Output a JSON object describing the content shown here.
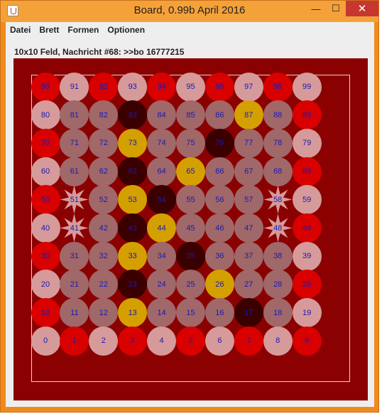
{
  "window": {
    "title": "Board, 0.99b April 2016",
    "minimize_glyph": "—",
    "maximize_glyph": "☐",
    "close_glyph": "✕"
  },
  "menu": {
    "items": [
      "Datei",
      "Brett",
      "Formen",
      "Optionen"
    ]
  },
  "status": "10x10 Feld, Nachricht #68: >>bo 16777215",
  "colors": {
    "board_bg": "#8b0000",
    "red": "#d90000",
    "pink": "#d69a9a",
    "mauve": "#a06868",
    "dark": "#3a0000",
    "gold": "#d4a000",
    "number": "#1a1ab0"
  },
  "board": {
    "columns": 10,
    "rows": 10,
    "rows_top_to_bottom": [
      [
        {
          "n": "90",
          "c": "red"
        },
        {
          "n": "91",
          "c": "pink"
        },
        {
          "n": "92",
          "c": "red"
        },
        {
          "n": "93",
          "c": "pink"
        },
        {
          "n": "94",
          "c": "red"
        },
        {
          "n": "95",
          "c": "pink"
        },
        {
          "n": "96",
          "c": "red"
        },
        {
          "n": "97",
          "c": "pink"
        },
        {
          "n": "98",
          "c": "red"
        },
        {
          "n": "99",
          "c": "pink"
        }
      ],
      [
        {
          "n": "80",
          "c": "pink"
        },
        {
          "n": "81",
          "c": "mauve"
        },
        {
          "n": "82",
          "c": "mauve"
        },
        {
          "n": "83",
          "c": "dark"
        },
        {
          "n": "84",
          "c": "mauve"
        },
        {
          "n": "85",
          "c": "mauve"
        },
        {
          "n": "86",
          "c": "mauve"
        },
        {
          "n": "87",
          "c": "gold"
        },
        {
          "n": "88",
          "c": "mauve"
        },
        {
          "n": "89",
          "c": "red"
        }
      ],
      [
        {
          "n": "70",
          "c": "red"
        },
        {
          "n": "71",
          "c": "mauve"
        },
        {
          "n": "72",
          "c": "mauve"
        },
        {
          "n": "73",
          "c": "gold"
        },
        {
          "n": "74",
          "c": "mauve"
        },
        {
          "n": "75",
          "c": "mauve"
        },
        {
          "n": "76",
          "c": "dark"
        },
        {
          "n": "77",
          "c": "mauve"
        },
        {
          "n": "78",
          "c": "mauve"
        },
        {
          "n": "79",
          "c": "pink"
        }
      ],
      [
        {
          "n": "60",
          "c": "pink"
        },
        {
          "n": "61",
          "c": "mauve"
        },
        {
          "n": "62",
          "c": "mauve"
        },
        {
          "n": "63",
          "c": "dark"
        },
        {
          "n": "64",
          "c": "mauve"
        },
        {
          "n": "65",
          "c": "gold"
        },
        {
          "n": "66",
          "c": "mauve"
        },
        {
          "n": "67",
          "c": "mauve"
        },
        {
          "n": "68",
          "c": "mauve"
        },
        {
          "n": "69",
          "c": "red"
        }
      ],
      [
        {
          "n": "50",
          "c": "red"
        },
        {
          "n": "51",
          "c": "pink",
          "s": "star"
        },
        {
          "n": "52",
          "c": "mauve"
        },
        {
          "n": "53",
          "c": "gold"
        },
        {
          "n": "54",
          "c": "dark"
        },
        {
          "n": "55",
          "c": "mauve"
        },
        {
          "n": "56",
          "c": "mauve"
        },
        {
          "n": "57",
          "c": "mauve"
        },
        {
          "n": "58",
          "c": "pink",
          "s": "star"
        },
        {
          "n": "59",
          "c": "pink"
        }
      ],
      [
        {
          "n": "40",
          "c": "pink"
        },
        {
          "n": "41",
          "c": "pink",
          "s": "star"
        },
        {
          "n": "42",
          "c": "mauve"
        },
        {
          "n": "43",
          "c": "dark"
        },
        {
          "n": "44",
          "c": "gold"
        },
        {
          "n": "45",
          "c": "mauve"
        },
        {
          "n": "46",
          "c": "mauve"
        },
        {
          "n": "47",
          "c": "mauve"
        },
        {
          "n": "48",
          "c": "pink",
          "s": "star"
        },
        {
          "n": "49",
          "c": "red"
        }
      ],
      [
        {
          "n": "30",
          "c": "red"
        },
        {
          "n": "31",
          "c": "mauve"
        },
        {
          "n": "32",
          "c": "mauve"
        },
        {
          "n": "33",
          "c": "gold"
        },
        {
          "n": "34",
          "c": "mauve"
        },
        {
          "n": "35",
          "c": "dark"
        },
        {
          "n": "36",
          "c": "mauve"
        },
        {
          "n": "37",
          "c": "mauve"
        },
        {
          "n": "38",
          "c": "mauve"
        },
        {
          "n": "39",
          "c": "pink"
        }
      ],
      [
        {
          "n": "20",
          "c": "pink"
        },
        {
          "n": "21",
          "c": "mauve"
        },
        {
          "n": "22",
          "c": "mauve"
        },
        {
          "n": "23",
          "c": "dark"
        },
        {
          "n": "24",
          "c": "mauve"
        },
        {
          "n": "25",
          "c": "mauve"
        },
        {
          "n": "26",
          "c": "gold"
        },
        {
          "n": "27",
          "c": "mauve"
        },
        {
          "n": "28",
          "c": "mauve"
        },
        {
          "n": "29",
          "c": "red"
        }
      ],
      [
        {
          "n": "10",
          "c": "red"
        },
        {
          "n": "11",
          "c": "mauve"
        },
        {
          "n": "12",
          "c": "mauve"
        },
        {
          "n": "13",
          "c": "gold"
        },
        {
          "n": "14",
          "c": "mauve"
        },
        {
          "n": "15",
          "c": "mauve"
        },
        {
          "n": "16",
          "c": "mauve"
        },
        {
          "n": "17",
          "c": "dark"
        },
        {
          "n": "18",
          "c": "mauve"
        },
        {
          "n": "19",
          "c": "pink"
        }
      ],
      [
        {
          "n": "0",
          "c": "pink"
        },
        {
          "n": "1",
          "c": "red"
        },
        {
          "n": "2",
          "c": "pink"
        },
        {
          "n": "3",
          "c": "red"
        },
        {
          "n": "4",
          "c": "pink"
        },
        {
          "n": "5",
          "c": "red"
        },
        {
          "n": "6",
          "c": "pink"
        },
        {
          "n": "7",
          "c": "red"
        },
        {
          "n": "8",
          "c": "pink"
        },
        {
          "n": "9",
          "c": "red"
        }
      ]
    ]
  }
}
